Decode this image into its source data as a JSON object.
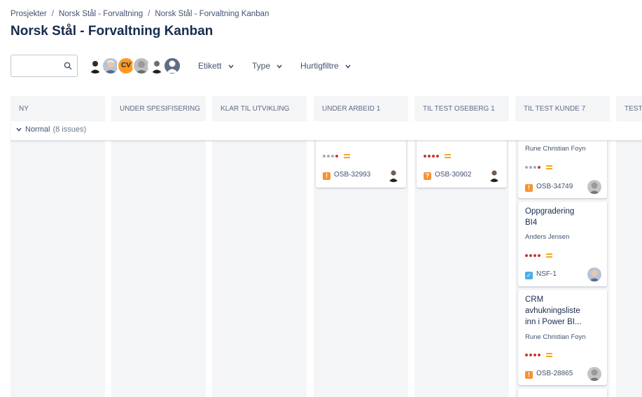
{
  "breadcrumb": {
    "items": [
      "Prosjekter",
      "Norsk Stål - Forvaltning",
      "Norsk Stål - Forvaltning Kanban"
    ],
    "separator": "/"
  },
  "page": {
    "title": "Norsk Stål - Forvaltning Kanban"
  },
  "toolbar": {
    "search_placeholder": "",
    "avatar_initials": "CV",
    "filters": [
      {
        "label": "Etikett"
      },
      {
        "label": "Type"
      },
      {
        "label": "Hurtigfiltre"
      }
    ]
  },
  "columns": [
    {
      "title": "NY"
    },
    {
      "title": "UNDER SPESIFISERING"
    },
    {
      "title": "KLAR TIL UTVIKLING"
    },
    {
      "title": "UNDER ARBEID 1"
    },
    {
      "title": "TIL TEST OSEBERG 1"
    },
    {
      "title": "TIL TEST KUNDE 7"
    },
    {
      "title": "TEST O"
    }
  ],
  "swimlane": {
    "label": "Normal",
    "count": "(8 issues)"
  },
  "cards": [
    {
      "column": "UNDER ARBEID 1",
      "summary": "",
      "assignee": "",
      "priority": "low",
      "type": "bug",
      "key": "OSB-32993"
    },
    {
      "column": "TIL TEST OSEBERG 1",
      "summary": "",
      "assignee": "",
      "priority": "high",
      "type": "question",
      "key": "OSB-30902"
    },
    {
      "column": "TIL TEST KUNDE 7",
      "summary": "",
      "assignee": "Rune Christian Foyn",
      "priority": "low",
      "type": "bug",
      "key": "OSB-34749"
    },
    {
      "column": "TIL TEST KUNDE 7",
      "summary": "Oppgradering BI4",
      "assignee": "Anders Jensen",
      "priority": "high",
      "type": "task",
      "key": "NSF-1"
    },
    {
      "column": "TIL TEST KUNDE 7",
      "summary": "CRM avhukningsliste inn i Power BI...",
      "assignee": "Rune Christian Foyn",
      "priority": "high",
      "type": "bug",
      "key": "OSB-28865"
    }
  ],
  "colors": {
    "column_bg": "#f4f5f7",
    "priority_red": "#c9372c",
    "priority_grey": "#a5adba",
    "medium_yellow": "#f5a623",
    "bug_orange": "#f79232",
    "task_blue": "#4bade8",
    "avatar_orange": "#ff991f"
  }
}
